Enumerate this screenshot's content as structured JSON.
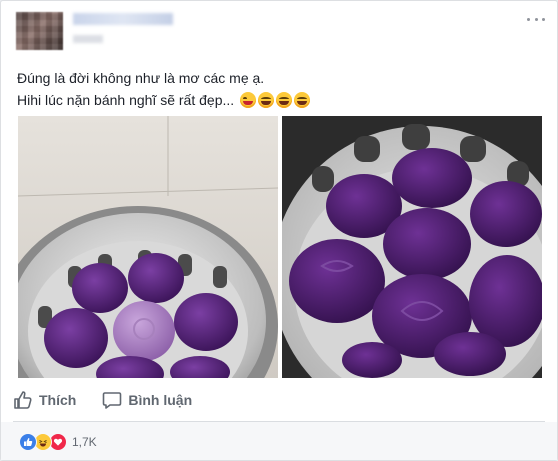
{
  "post": {
    "author_name": "",
    "timestamp": "",
    "text_lines": [
      "Đúng là đời không như là mơ các mẹ ạ.",
      "Hihi lúc nặn bánh nghĩ sẽ rất đẹp..."
    ],
    "emojis": [
      "winking-tongue-emoji",
      "laughing-emoji",
      "laughing-emoji",
      "laughing-emoji"
    ],
    "photos": [
      "purple-cakes-photo-left",
      "purple-cakes-photo-right"
    ]
  },
  "actions": {
    "like_label": "Thích",
    "comment_label": "Bình luận"
  },
  "reactions": {
    "icons": [
      "like-reaction-icon",
      "haha-reaction-icon",
      "love-reaction-icon"
    ],
    "count": "1,7K"
  },
  "colors": {
    "brand_like": "#3b7fe8",
    "haha": "#fcc93a",
    "love": "#f0284a",
    "text_secondary": "#606770",
    "purple_cake": "#4a1f6e"
  }
}
